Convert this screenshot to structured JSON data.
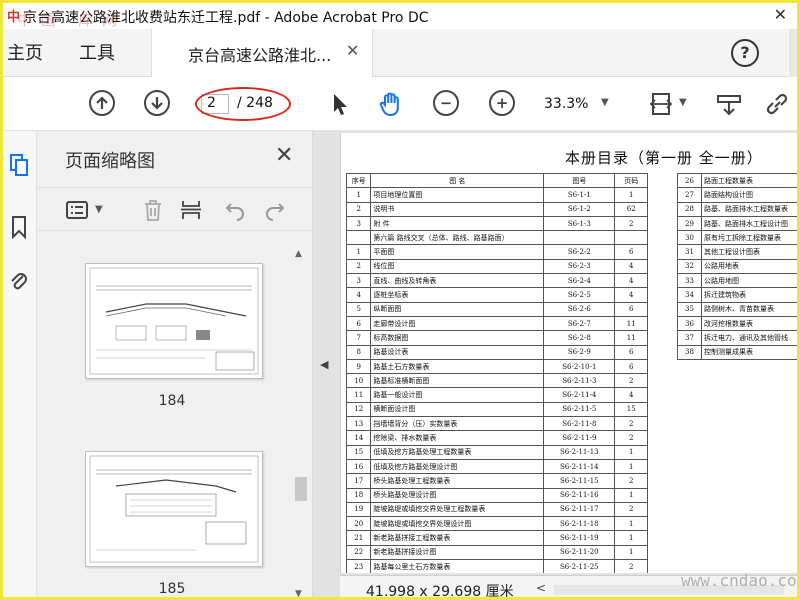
{
  "window": {
    "title": "京台高速公路淮北收费站东迁工程.pdf - Adobe Acrobat Pro DC",
    "app_glyph": "中",
    "close_glyph": "✕",
    "watermark_top": "中 国 · 库 网"
  },
  "tabs": {
    "home": "主页",
    "tools": "工具",
    "document": "京台高速公路淮北...",
    "document_close": "✕",
    "help": "?"
  },
  "toolbar": {
    "current_page": "2",
    "total_pages": "/ 248",
    "zoom": "33.3%",
    "prev_icon": "arrow-up",
    "next_icon": "arrow-down",
    "zoom_out_glyph": "−",
    "zoom_in_glyph": "+",
    "caret": "▼",
    "highlight_color": "#d8281e"
  },
  "sidebar": {
    "title": "页面缩略图",
    "close": "✕",
    "thumbnails": [
      {
        "label": "184"
      },
      {
        "label": "185"
      }
    ],
    "scroll_up": "▲",
    "scroll_down": "▼",
    "collapse": "◀"
  },
  "document": {
    "heading": "本册目录（第一册 全一册）",
    "left_headers": [
      "序号",
      "图 名",
      "图号",
      "页码"
    ],
    "left_rows": [
      [
        "1",
        "项目地理位置图",
        "S6-1-1",
        "1"
      ],
      [
        "2",
        "说明书",
        "S6-1-2",
        "62"
      ],
      [
        "3",
        "附 件",
        "S6-1-3",
        "2"
      ],
      [
        "",
        "第六篇 路线交叉（总体、路线、路基路面）",
        "",
        ""
      ],
      [
        "1",
        "平面图",
        "S6-2-2",
        "6"
      ],
      [
        "2",
        "线位图",
        "S6-2-3",
        "4"
      ],
      [
        "3",
        "直线、曲线及转角表",
        "S6-2-4",
        "4"
      ],
      [
        "4",
        "逐桩坐标表",
        "S6-2-5",
        "4"
      ],
      [
        "5",
        "纵断面图",
        "S6-2-6",
        "6"
      ],
      [
        "6",
        "走廊带设计图",
        "S6-2-7",
        "11"
      ],
      [
        "7",
        "标高数据图",
        "S6-2-8",
        "11"
      ],
      [
        "8",
        "路基设计表",
        "S6-2-9",
        "6"
      ],
      [
        "9",
        "路基土石方数量表",
        "S6-2-10-1",
        "6"
      ],
      [
        "10",
        "路基标准横断面图",
        "S6-2-11-3",
        "2"
      ],
      [
        "11",
        "路基一般设计图",
        "S6-2-11-4",
        "4"
      ],
      [
        "12",
        "横断面设计图",
        "S6-2-11-5",
        "15"
      ],
      [
        "13",
        "挡墙墙背分（压）实数量表",
        "S6-2-11-8",
        "2"
      ],
      [
        "14",
        "挖除梁、排水数量表",
        "S6-2-11-9",
        "2"
      ],
      [
        "15",
        "低填及挖方路基处理工程数量表",
        "S6-2-11-13",
        "1"
      ],
      [
        "16",
        "低填及挖方路基处理设计图",
        "S6-2-11-14",
        "1"
      ],
      [
        "17",
        "桥头路基处理工程数量表",
        "S6-2-11-15",
        "2"
      ],
      [
        "18",
        "桥头路基处理设计图",
        "S6-2-11-16",
        "1"
      ],
      [
        "19",
        "陡坡路堤或填挖交界处理工程数量表",
        "S6-2-11-17",
        "2"
      ],
      [
        "20",
        "陡坡路堤或填挖交界处理设计图",
        "S6-2-11-18",
        "1"
      ],
      [
        "21",
        "新老路基拼接工程数量表",
        "S6-2-11-19",
        "1"
      ],
      [
        "22",
        "新老路基拼接设计图",
        "S6-2-11-20",
        "1"
      ],
      [
        "23",
        "路基每公里土石方数量表",
        "S6-2-11-25",
        "2"
      ],
      [
        "24",
        "",
        "S6-2-11-26",
        ""
      ]
    ],
    "right_rows": [
      [
        "26",
        "路面工程数量表"
      ],
      [
        "27",
        "路面结构设计图"
      ],
      [
        "28",
        "路基、路面排水工程数量表"
      ],
      [
        "29",
        "路基、路面排水工程设计图"
      ],
      [
        "30",
        "原有圬工拆除工程数量表"
      ],
      [
        "31",
        "其他工程设计图表"
      ],
      [
        "32",
        "公路用地表"
      ],
      [
        "33",
        "公路用地图"
      ],
      [
        "34",
        "拆迁建筑物表"
      ],
      [
        "35",
        "路侧树木、青苗数量表"
      ],
      [
        "36",
        "改河挖根数量表"
      ],
      [
        "37",
        "拆迁电力、通讯及其他管线"
      ],
      [
        "38",
        "控制测量成果表"
      ]
    ]
  },
  "status": {
    "page_size": "41.998 x 29.698 厘米",
    "scroll_left": "<"
  },
  "watermark_site": "www.cndao.com"
}
